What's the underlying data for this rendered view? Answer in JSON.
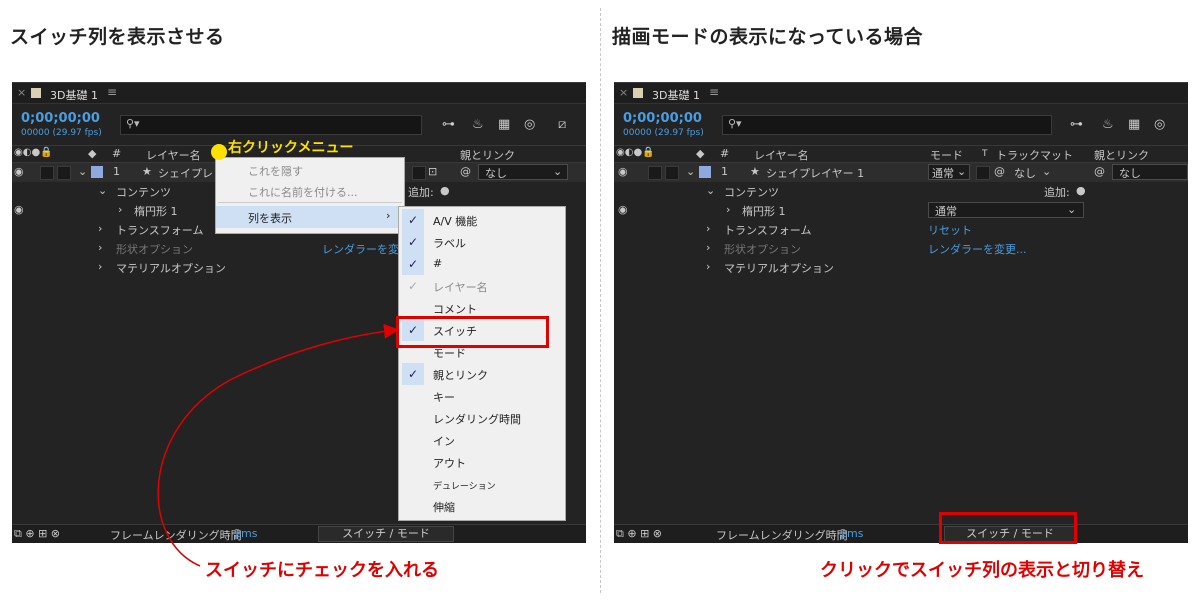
{
  "left": {
    "heading": "スイッチ列を表示させる",
    "tab_name": "3D基礎 1",
    "timecode": "0;00;00;00",
    "fps": "00000 (29.97 fps)",
    "col_layer_name": "レイヤー名",
    "col_parent": "親とリンク",
    "layer_num": "1",
    "layer_name": "シェイプレ",
    "add_label": "追加:",
    "parent_value": "なし",
    "rows": [
      "コンテンツ",
      "楕円形 1",
      "トランスフォーム",
      "形状オプション",
      "マテリアルオプション"
    ],
    "renderer_link": "レンダラーを変",
    "callout": "右クリックメニュー",
    "ctx1": [
      "これを隠す",
      "これに名前を付ける...",
      "列を表示"
    ],
    "ctx2": [
      "A/V 機能",
      "ラベル",
      "#",
      "レイヤー名",
      "コメント",
      "スイッチ",
      "モード",
      "親とリンク",
      "キー",
      "レンダリング時間",
      "イン",
      "アウト",
      "デュレーション",
      "伸縮"
    ],
    "status_label": "フレームレンダリング時間",
    "status_time": "2ms",
    "toggle_label": "スイッチ / モード",
    "caption": "スイッチにチェックを入れる"
  },
  "right": {
    "heading": "描画モードの表示になっている場合",
    "tab_name": "3D基礎 1",
    "timecode": "0;00;00;00",
    "fps": "00000 (29.97 fps)",
    "col_layer_name": "レイヤー名",
    "col_mode": "モード",
    "col_t": "T",
    "col_trackmatte": "トラックマット",
    "col_parent": "親とリンク",
    "layer_num": "1",
    "layer_name": "シェイプレイヤー 1",
    "mode_value": "通常",
    "trackmatte_value": "なし",
    "parent_value": "なし",
    "add_label": "追加:",
    "rows": [
      "コンテンツ",
      "楕円形 1",
      "トランスフォーム",
      "形状オプション",
      "マテリアルオプション"
    ],
    "ellipse_mode": "通常",
    "reset_link": "リセット",
    "renderer_link": "レンダラーを変更...",
    "status_label": "フレームレンダリング時間",
    "status_time": "2ms",
    "toggle_label": "スイッチ / モード",
    "caption": "クリックでスイッチ列の表示と切り替え"
  },
  "colors": {
    "accent_blue": "#4a9de0",
    "highlight_red": "#e00000",
    "callout_yellow": "#ffe100",
    "panel_bg": "#232323"
  },
  "icons": [
    "close-icon",
    "hamburger-icon",
    "search-icon",
    "eye-icon",
    "speaker-icon",
    "solo-icon",
    "lock-icon",
    "label-tag-icon",
    "star-icon",
    "spiral-pickwhip-icon",
    "checkmark-icon",
    "chevron-right-icon",
    "chevron-down-icon"
  ]
}
